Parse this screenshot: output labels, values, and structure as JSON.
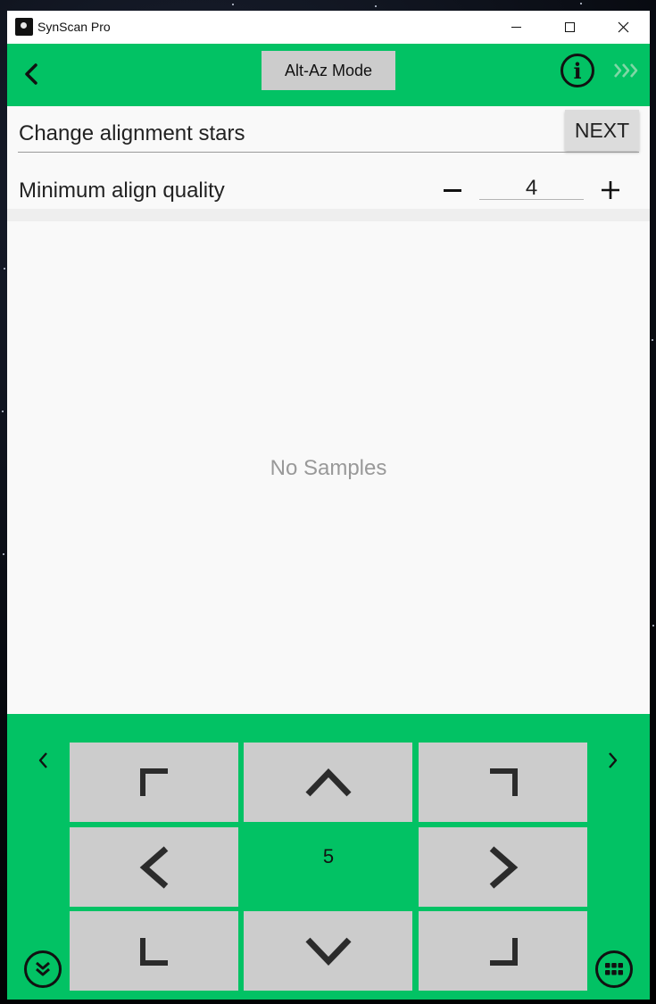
{
  "window": {
    "title": "SynScan Pro"
  },
  "header": {
    "mode_label": "Alt-Az Mode"
  },
  "alignment": {
    "change_stars_label": "Change alignment stars",
    "next_label": "NEXT",
    "min_quality_label": "Minimum align quality",
    "min_quality_value": "4"
  },
  "samples": {
    "empty_text": "No Samples"
  },
  "pad": {
    "speed_value": "5"
  },
  "colors": {
    "accent_green": "#02c264",
    "button_gray": "#cccccc",
    "background": "#f9f9f9"
  },
  "icons": [
    "back-arrow-icon",
    "info-icon",
    "triple-chevron-icon",
    "minus-icon",
    "plus-icon",
    "chevron-left-icon",
    "chevron-right-icon",
    "double-chevron-down-icon",
    "keypad-grid-icon"
  ]
}
